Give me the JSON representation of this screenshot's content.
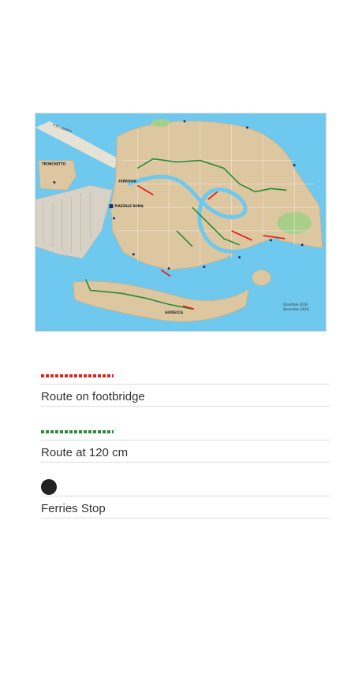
{
  "map": {
    "colors": {
      "water": "#6fc9ef",
      "land": "#dcc7a0",
      "park": "#a8cf8a",
      "route_footbridge": "#e0231e",
      "route_120": "#2a8a3a",
      "ferry_stop": "#1f2f6b"
    },
    "labels": {
      "ponte_liberta": "P.TE LIBERTA",
      "tronchetto": "TRONCHETTO",
      "ferrovia": "FERROVIA",
      "piazzale_roma": "PIAZZALE ROMA",
      "giudecca": "GIUDECCA",
      "date_it": "Dicembre 2018",
      "date_en": "December 2018"
    }
  },
  "legend": {
    "items": [
      {
        "label": "Route on footbridge",
        "symbol": "dashed-red"
      },
      {
        "label": "Route at 120 cm",
        "symbol": "dashed-green"
      },
      {
        "label": "Ferries Stop",
        "symbol": "black-dot"
      }
    ]
  }
}
